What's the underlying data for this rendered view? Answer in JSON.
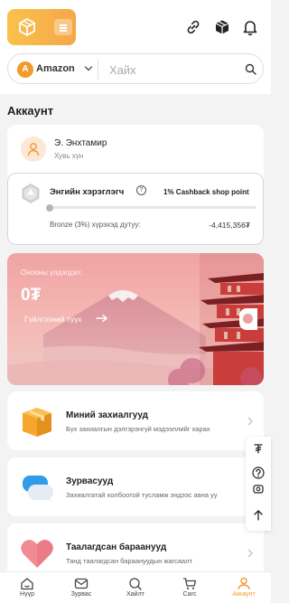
{
  "header": {
    "logo_icon": "cube-logo-icon",
    "menu_icon": "menu-icon",
    "actions": [
      "link-icon",
      "box-icon",
      "bell-icon"
    ]
  },
  "search": {
    "store_badge": "A",
    "store_name": "Amazon",
    "placeholder": "Хайх",
    "value": ""
  },
  "account": {
    "title": "Аккаунт",
    "user_name": "Э. Энхтамир",
    "user_role": "Хувь хүн",
    "level_name": "Энгийн хэрэглэгч",
    "cashback": "1% Cashback shop point",
    "level_progress": 0.02,
    "next_level_note": "Bronze (3%) хүрэхэд дутуу:",
    "next_level_amount": "-4,415,356₮"
  },
  "balance": {
    "label": "Онооны үлдэгдэл:",
    "value": "0₮",
    "history_link": "Гүйлгээний түүх"
  },
  "menu": [
    {
      "title": "Миний захиалгууд",
      "subtitle": "Бүх захиалгын дэлгэрэнгүй мэдээллийг харах",
      "icon": "package-box-icon"
    },
    {
      "title": "Зурвасууд",
      "subtitle": "Захиалгатай холбоотой тусламж эндээс авна уу",
      "icon": "chat-bubbles-icon"
    },
    {
      "title": "Таалагдсан бараанууд",
      "subtitle": "Танд таалагдсан бараануудын жагсаалт",
      "icon": "heart-icon"
    }
  ],
  "float_rail": [
    "tugrik-icon",
    "help-icon",
    "currency-exchange-icon",
    "arrow-up-icon"
  ],
  "nav": [
    {
      "label": "Нүүр",
      "icon": "home-icon"
    },
    {
      "label": "Зурвас",
      "icon": "mail-icon"
    },
    {
      "label": "Хайлт",
      "icon": "search-icon"
    },
    {
      "label": "Сагс",
      "icon": "cart-icon"
    },
    {
      "label": "Аккаунт",
      "icon": "user-icon"
    }
  ],
  "colors": {
    "accent": "#f29a2b",
    "logo_gradient_start": "#f8c24a",
    "logo_gradient_end": "#f6a64a",
    "balance_card": "#f4a9a6"
  }
}
